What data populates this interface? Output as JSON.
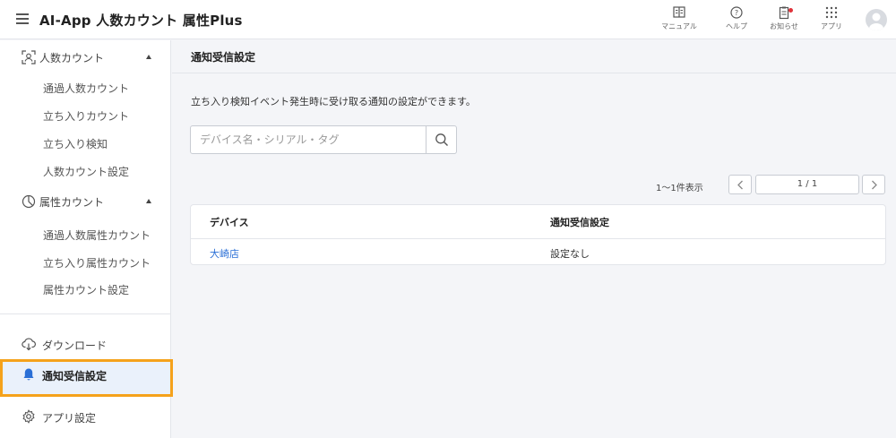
{
  "header": {
    "title": "AI-App 人数カウント 属性Plus",
    "buttons": [
      {
        "id": "manual",
        "icon": "book-icon",
        "label": "マニュアル"
      },
      {
        "id": "help",
        "icon": "help-circle-icon",
        "label": "ヘルプ"
      },
      {
        "id": "news",
        "icon": "clipboard-icon",
        "label": "お知らせ"
      },
      {
        "id": "apps",
        "icon": "grid-icon",
        "label": "アプリ"
      }
    ],
    "notification_dot_color": "#e0323a"
  },
  "sidebar": {
    "sections": [
      {
        "label": "人数カウント",
        "icon": "people-count-icon",
        "expanded": true,
        "items": [
          "通過人数カウント",
          "立ち入りカウント",
          "立ち入り検知",
          "人数カウント設定"
        ]
      },
      {
        "label": "属性カウント",
        "icon": "attribute-count-icon",
        "expanded": true,
        "items": [
          "通過人数属性カウント",
          "立ち入り属性カウント",
          "属性カウント設定"
        ]
      }
    ],
    "bottom_items": [
      {
        "label": "ダウンロード",
        "icon": "cloud-download-icon",
        "active": false
      },
      {
        "label": "通知受信設定",
        "icon": "bell-icon",
        "active": true
      },
      {
        "label": "アプリ設定",
        "icon": "gear-icon",
        "active": false
      }
    ],
    "active_highlight_color": "#f5a21b"
  },
  "main": {
    "page_title": "通知受信設定",
    "description": "立ち入り検知イベント発生時に受け取る通知の設定ができます。",
    "search": {
      "placeholder": "デバイス名・シリアル・タグ",
      "value": ""
    },
    "pager": {
      "info": "1〜1件表示",
      "page": "1 / 1"
    },
    "table": {
      "columns": [
        "デバイス",
        "通知受信設定"
      ],
      "rows": [
        {
          "device": "大崎店",
          "setting": "設定なし"
        }
      ]
    },
    "link_color": "#2a6fd6"
  }
}
